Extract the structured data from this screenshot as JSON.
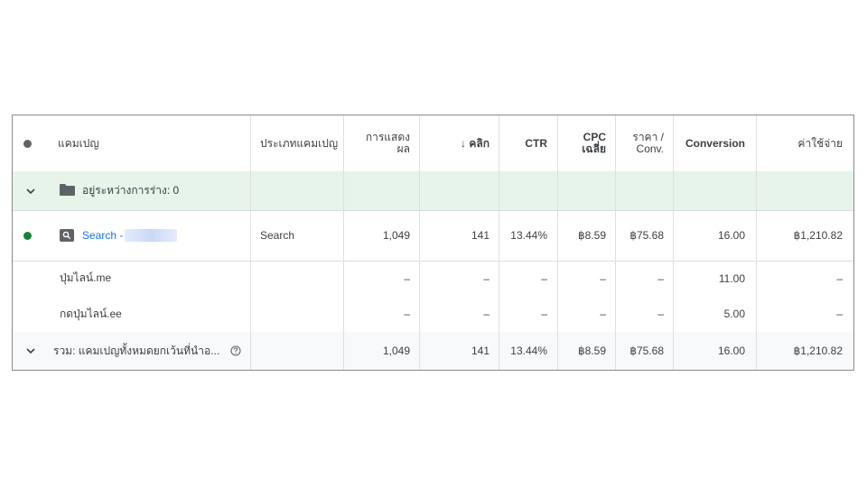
{
  "columns": {
    "status": "",
    "campaign": "แคมเปญ",
    "campaign_type": "ประเภทแคมเปญ",
    "impressions": "การแสดง\nผล",
    "clicks": "↓ คลิก",
    "ctr": "CTR",
    "avg_cpc": "CPC\nเฉลี่ย",
    "cost_per_conv": "ราคา /\nConv.",
    "conversions": "Conversion",
    "cost": "ค่าใช้จ่าย"
  },
  "colors": {
    "status_gray": "#5f6368",
    "status_green": "#188038",
    "group_row_bg": "#e6f4ea",
    "link_blue": "#1a73e8"
  },
  "group_row": {
    "icon": "folder-icon",
    "label": "อยู่ระหว่างการร่าง: 0"
  },
  "campaign_row": {
    "name": "Search -",
    "type": "Search",
    "impressions": "1,049",
    "clicks": "141",
    "ctr": "13.44%",
    "avg_cpc": "฿8.59",
    "cost_per_conv": "฿75.68",
    "conversions": "16.00",
    "cost": "฿1,210.82"
  },
  "sub_rows": [
    {
      "label": "ปุ่มไลน์.me",
      "impressions": "–",
      "clicks": "–",
      "ctr": "–",
      "avg_cpc": "–",
      "cost_per_conv": "–",
      "conversions": "11.00",
      "cost": "–"
    },
    {
      "label": "กดปุ่มไลน์.ee",
      "impressions": "–",
      "clicks": "–",
      "ctr": "–",
      "avg_cpc": "–",
      "cost_per_conv": "–",
      "conversions": "5.00",
      "cost": "–"
    }
  ],
  "total_row": {
    "label": "รวม: แคมเปญทั้งหมดยกเว้นที่นำอ...",
    "impressions": "1,049",
    "clicks": "141",
    "ctr": "13.44%",
    "avg_cpc": "฿8.59",
    "cost_per_conv": "฿75.68",
    "conversions": "16.00",
    "cost": "฿1,210.82"
  }
}
